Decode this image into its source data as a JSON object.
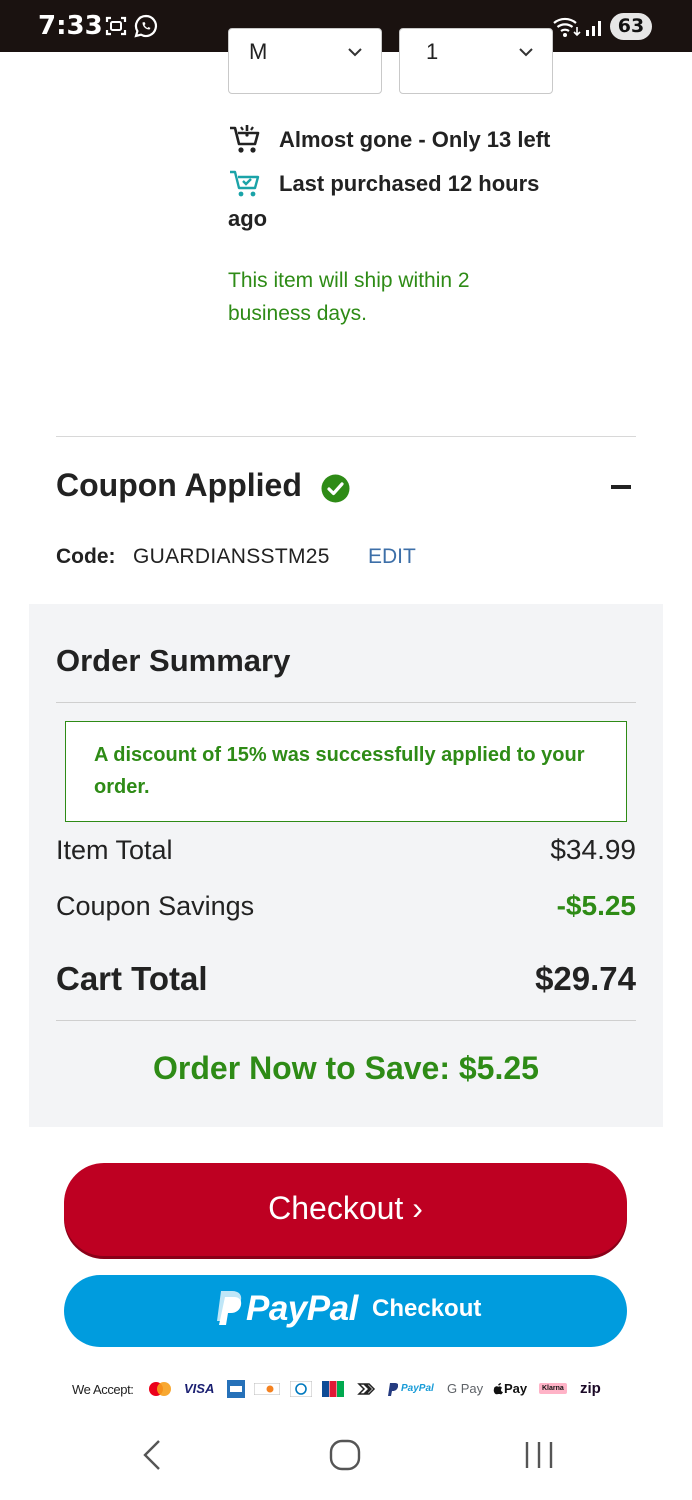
{
  "status_bar": {
    "time": "7:33",
    "battery": "63",
    "icons": [
      "screenshot-icon",
      "whatsapp-icon",
      "wifi-icon",
      "signal-icon",
      "battery-icon"
    ]
  },
  "product": {
    "size_select_value": "M",
    "qty_select_value": "1",
    "stock_line": "Almost gone - Only 13 left",
    "purchase_line": "Last purchased 12 hours",
    "purchase_line_cont": "ago",
    "ship_note": "This item will ship within 2 business days."
  },
  "coupon": {
    "title": "Coupon Applied",
    "code_label": "Code:",
    "code_value": "GUARDIANSSTM25",
    "edit_label": "EDIT"
  },
  "order_summary": {
    "title": "Order Summary",
    "alert": "A discount of 15% was successfully applied to your order.",
    "item_total_label": "Item Total",
    "item_total_value": "$34.99",
    "coupon_savings_label": "Coupon Savings",
    "coupon_savings_value": "-$5.25",
    "cart_total_label": "Cart Total",
    "cart_total_value": "$29.74",
    "save_message": "Order Now to Save: $5.25"
  },
  "actions": {
    "checkout_label": "Checkout ›",
    "paypal_brand": "PayPal",
    "paypal_checkout": "Checkout"
  },
  "payments": {
    "label": "We Accept:",
    "methods": [
      "VISA",
      "PayPal",
      "G Pay",
      "Pay",
      "Klarna",
      "zip"
    ]
  },
  "colors": {
    "green": "#2e8b16",
    "checkout_red": "#be0022",
    "paypal_blue": "#009cde",
    "link_blue": "#3d6fa8"
  }
}
